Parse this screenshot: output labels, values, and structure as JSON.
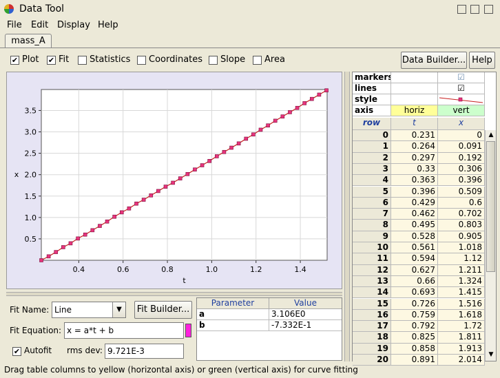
{
  "window": {
    "title": "Data Tool"
  },
  "menu": [
    "File",
    "Edit",
    "Display",
    "Help"
  ],
  "tab": {
    "label": "mass_A"
  },
  "toolbar": {
    "checkboxes": [
      {
        "label": "Plot",
        "checked": true
      },
      {
        "label": "Fit",
        "checked": true
      },
      {
        "label": "Statistics",
        "checked": false
      },
      {
        "label": "Coordinates",
        "checked": false
      },
      {
        "label": "Slope",
        "checked": false
      },
      {
        "label": "Area",
        "checked": false
      }
    ],
    "data_builder": "Data Builder...",
    "help": "Help"
  },
  "chart_data": {
    "type": "line",
    "xlabel": "t",
    "ylabel": "x",
    "xlim": [
      0.231,
      1.521
    ],
    "ylim": [
      0,
      3.99
    ],
    "xticks": [
      "0.4",
      "0.6",
      "0.8",
      "1.0",
      "1.2",
      "1.4"
    ],
    "yticks": [
      "0.5",
      "1.0",
      "1.5",
      "2.0",
      "2.5",
      "3.0",
      "3.5"
    ],
    "grid": true,
    "marker_color": "#e8347c",
    "line_color": "#c81e1e",
    "series": [
      {
        "x": [
          0.231,
          0.264,
          0.297,
          0.33,
          0.363,
          0.396,
          0.429,
          0.462,
          0.495,
          0.528,
          0.561,
          0.594,
          0.627,
          0.66,
          0.693,
          0.726,
          0.759,
          0.792,
          0.825,
          0.858,
          0.891,
          0.924,
          0.957,
          0.99,
          1.023,
          1.056,
          1.089,
          1.122,
          1.155,
          1.188,
          1.221,
          1.254,
          1.287,
          1.32,
          1.353,
          1.386,
          1.419,
          1.452,
          1.485,
          1.518
        ],
        "y": [
          0,
          0.091,
          0.192,
          0.306,
          0.396,
          0.509,
          0.6,
          0.702,
          0.803,
          0.905,
          1.018,
          1.12,
          1.211,
          1.324,
          1.415,
          1.516,
          1.618,
          1.72,
          1.811,
          1.913,
          2.014,
          2.12,
          2.22,
          2.32,
          2.43,
          2.53,
          2.63,
          2.73,
          2.84,
          2.94,
          3.05,
          3.15,
          3.26,
          3.36,
          3.46,
          3.56,
          3.67,
          3.77,
          3.87,
          3.97
        ]
      }
    ]
  },
  "fit": {
    "name_label": "Fit Name:",
    "name_value": "Line",
    "builder": "Fit Builder...",
    "equation_label": "Fit Equation:",
    "equation": "x = a*t + b",
    "autofit_label": "Autofit",
    "rms_label": "rms dev:",
    "rms_value": "9.721E-3"
  },
  "params": {
    "headers": [
      "Parameter",
      "Value"
    ],
    "rows": [
      [
        "a",
        "3.106E0"
      ],
      [
        "b",
        "-7.332E-1"
      ]
    ]
  },
  "data_table": {
    "prop_labels": [
      "markers",
      "lines",
      "style",
      "axis"
    ],
    "axis_horiz": "horiz",
    "axis_vert": "vert",
    "col_headers": [
      "row",
      "t",
      "x"
    ],
    "rows": [
      [
        "0",
        "0.231",
        "0"
      ],
      [
        "1",
        "0.264",
        "0.091"
      ],
      [
        "2",
        "0.297",
        "0.192"
      ],
      [
        "3",
        "0.33",
        "0.306"
      ],
      [
        "4",
        "0.363",
        "0.396"
      ],
      [
        "5",
        "0.396",
        "0.509"
      ],
      [
        "6",
        "0.429",
        "0.6"
      ],
      [
        "7",
        "0.462",
        "0.702"
      ],
      [
        "8",
        "0.495",
        "0.803"
      ],
      [
        "9",
        "0.528",
        "0.905"
      ],
      [
        "10",
        "0.561",
        "1.018"
      ],
      [
        "11",
        "0.594",
        "1.12"
      ],
      [
        "12",
        "0.627",
        "1.211"
      ],
      [
        "13",
        "0.66",
        "1.324"
      ],
      [
        "14",
        "0.693",
        "1.415"
      ],
      [
        "15",
        "0.726",
        "1.516"
      ],
      [
        "16",
        "0.759",
        "1.618"
      ],
      [
        "17",
        "0.792",
        "1.72"
      ],
      [
        "18",
        "0.825",
        "1.811"
      ],
      [
        "19",
        "0.858",
        "1.913"
      ],
      [
        "20",
        "0.891",
        "2.014"
      ]
    ]
  },
  "status": "Drag table columns to yellow (horizontal axis) or green (vertical axis) for curve fitting"
}
